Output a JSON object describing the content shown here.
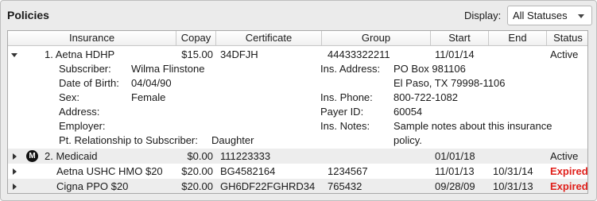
{
  "panel": {
    "title": "Policies",
    "display_label": "Display:",
    "status_filter": "All Statuses"
  },
  "columns": [
    "Insurance",
    "Copay",
    "Certificate",
    "Group",
    "Start",
    "End",
    "Status"
  ],
  "policies": [
    {
      "insurance": "1. Aetna HDHP",
      "copay": "$15.00",
      "certificate": "34DFJH",
      "group": "44433322211",
      "start": "11/01/14",
      "end": "",
      "status": "Active",
      "expanded": true
    },
    {
      "insurance": "2. Medicaid",
      "copay": "$0.00",
      "certificate": "111223333",
      "group": "",
      "start": "01/01/18",
      "end": "",
      "status": "Active",
      "badge": "M"
    },
    {
      "insurance": "Aetna USHC HMO $20",
      "copay": "$20.00",
      "certificate": "BG4582164",
      "group": "1234567",
      "start": "11/01/13",
      "end": "10/31/14",
      "status": "Expired"
    },
    {
      "insurance": "Cigna PPO $20",
      "copay": "$20.00",
      "certificate": "GH6DF22FGHRD34",
      "group": "765432",
      "start": "09/28/09",
      "end": "10/31/13",
      "status": "Expired"
    }
  ],
  "details": {
    "subscriber_label": "Subscriber:",
    "subscriber": "Wilma Flinstone",
    "dob_label": "Date of Birth:",
    "dob": "04/04/90",
    "sex_label": "Sex:",
    "sex": "Female",
    "address_label": "Address:",
    "employer_label": "Employer:",
    "relationship_label": "Pt. Relationship to Subscriber:",
    "relationship": "Daughter",
    "ins_address_label": "Ins. Address:",
    "ins_address_line1": "PO Box 981106",
    "ins_address_line2": "El Paso, TX 79998-1106",
    "ins_phone_label": "Ins. Phone:",
    "ins_phone": "800-722-1082",
    "payer_id_label": "Payer ID:",
    "payer_id": "60054",
    "ins_notes_label": "Ins. Notes:",
    "ins_notes_line1": "Sample notes about this insurance",
    "ins_notes_line2": "policy."
  },
  "colors": {
    "expired": "#e0201b",
    "panel_bg": "#ebebeb",
    "row_shade": "#ededed"
  }
}
